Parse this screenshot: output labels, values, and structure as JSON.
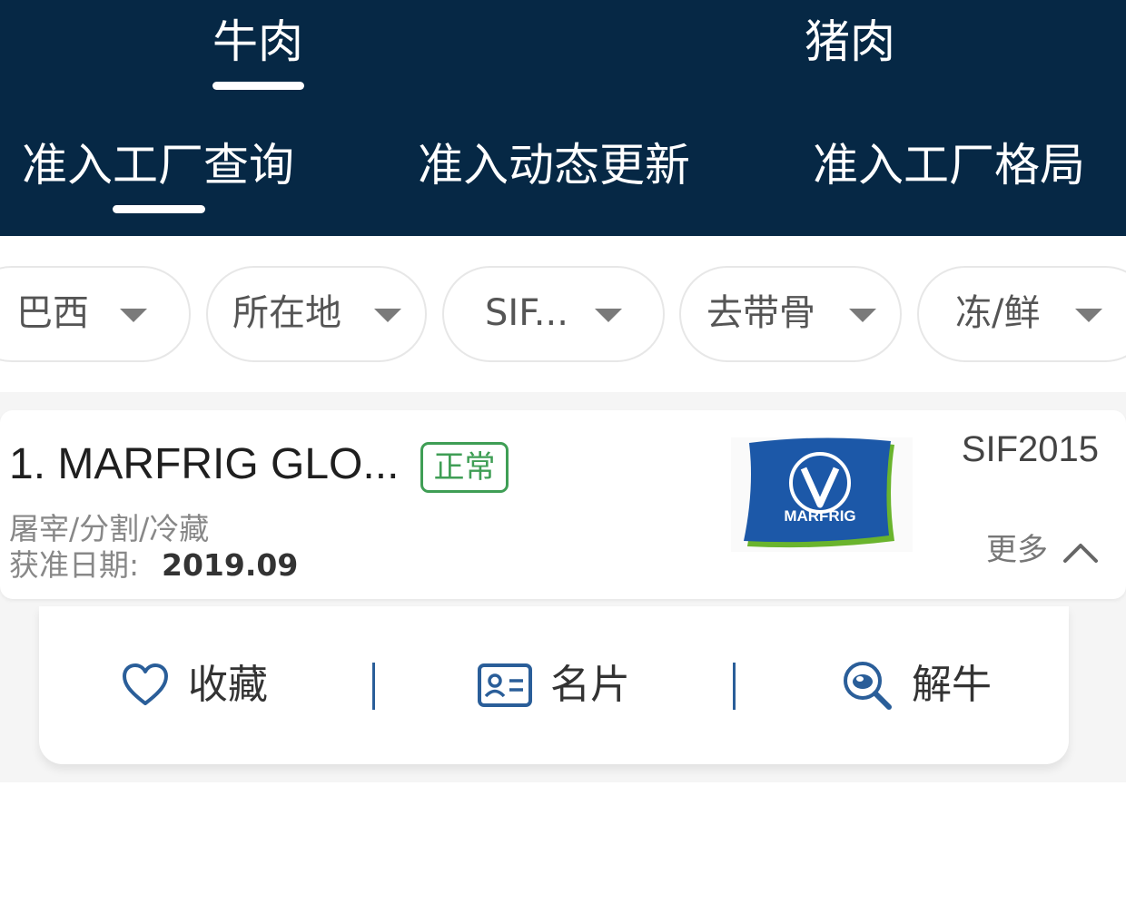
{
  "header": {
    "main_tabs": [
      "牛肉",
      "猪肉"
    ],
    "active_main_tab": 0,
    "sub_tabs": [
      "准入工厂查询",
      "准入动态更新",
      "准入工厂格局"
    ],
    "active_sub_tab": 0,
    "background_color": "#062845"
  },
  "filters": [
    {
      "label": "巴西"
    },
    {
      "label": "所在地"
    },
    {
      "label": "SIF..."
    },
    {
      "label": "去带骨"
    },
    {
      "label": "冻/鲜"
    }
  ],
  "company": {
    "name": "1. MARFRIG GLO...",
    "status": "正常",
    "status_color": "#3f9e55",
    "operations": "屠宰/分割/冷藏",
    "date_label": "获准日期:",
    "date_value": "2019.09",
    "logo_text": "MARFRIG",
    "sif_code": "SIF2015",
    "more_label": "更多"
  },
  "actions": [
    {
      "label": "收藏",
      "icon": "heart-icon"
    },
    {
      "label": "名片",
      "icon": "business-card-icon"
    },
    {
      "label": "解牛",
      "icon": "magnifier-meat-icon"
    }
  ],
  "accent_color": "#2a5e99"
}
